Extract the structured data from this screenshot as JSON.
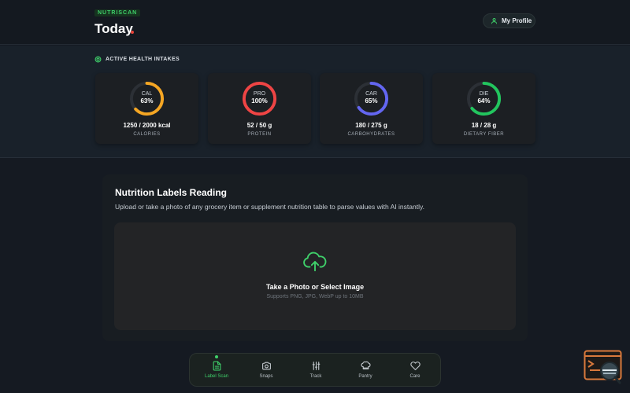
{
  "header": {
    "brand": "NUTRISCAN",
    "title": "Today",
    "profile_label": "My Profile"
  },
  "intakes": {
    "section_title": "ACTIVE HEALTH INTAKES",
    "cards": [
      {
        "abbr": "CAL",
        "percent": "63%",
        "fraction": 0.63,
        "value": "1250 / 2000 kcal",
        "label": "CALORIES",
        "color": "#f5a623"
      },
      {
        "abbr": "PRO",
        "percent": "100%",
        "fraction": 1.0,
        "value": "52 / 50 g",
        "label": "PROTEIN",
        "color": "#ef4444"
      },
      {
        "abbr": "CAR",
        "percent": "65%",
        "fraction": 0.65,
        "value": "180 / 275 g",
        "label": "CARBOHYDRATES",
        "color": "#6366f1"
      },
      {
        "abbr": "DIE",
        "percent": "64%",
        "fraction": 0.64,
        "value": "18 / 28 g",
        "label": "DIETARY FIBER",
        "color": "#22c55e"
      }
    ]
  },
  "upload": {
    "title": "Nutrition Labels Reading",
    "description": "Upload or take a photo of any grocery item or supplement nutrition table to parse values with AI instantly.",
    "drop_title": "Take a Photo or Select Image",
    "drop_hint": "Supports PNG, JPG, WebP up to 10MB",
    "icon": "cloud-upload-icon"
  },
  "nav": {
    "items": [
      {
        "label": "Label Scan",
        "icon": "document-icon",
        "active": true
      },
      {
        "label": "Snaps",
        "icon": "camera-icon",
        "active": false
      },
      {
        "label": "Track",
        "icon": "sliders-icon",
        "active": false
      },
      {
        "label": "Pantry",
        "icon": "chef-hat-icon",
        "active": false
      },
      {
        "label": "Care",
        "icon": "heart-icon",
        "active": false
      }
    ]
  },
  "colors": {
    "accent": "#3fd06a",
    "background": "#151a22",
    "title_dot": "#e8443a"
  }
}
